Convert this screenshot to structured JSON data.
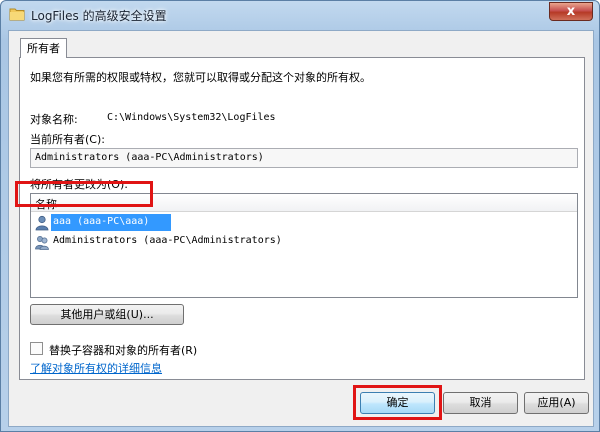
{
  "window": {
    "title": "LogFiles 的高级安全设置",
    "close_glyph": "x"
  },
  "tabs": [
    {
      "label": "所有者"
    }
  ],
  "owner_tab": {
    "intro": "如果您有所需的权限或特权，您就可以取得或分配这个对象的所有权。",
    "object_name_label": "对象名称:",
    "object_name_value": "C:\\Windows\\System32\\LogFiles",
    "current_owner_label": "当前所有者(C):",
    "current_owner_value": "Administrators (aaa-PC\\Administrators)",
    "change_owner_label": "将所有者更改为(O):",
    "list": {
      "column_header": "名称",
      "rows": [
        {
          "text": "aaa (aaa-PC\\aaa)",
          "icon": "user-icon",
          "selected": true
        },
        {
          "text": "Administrators (aaa-PC\\Administrators)",
          "icon": "group-icon",
          "selected": false
        }
      ]
    },
    "other_users_button": "其他用户或组(U)...",
    "replace_checkbox_label": "替换子容器和对象的所有者(R)",
    "replace_checked": false,
    "learn_more_link": "了解对象所有权的详细信息"
  },
  "footer": {
    "ok_label": "确定",
    "cancel_label": "取消",
    "apply_label": "应用(A)"
  },
  "colors": {
    "selection": "#3399ff",
    "highlight_annotation": "#e01414",
    "link": "#0066cc"
  }
}
